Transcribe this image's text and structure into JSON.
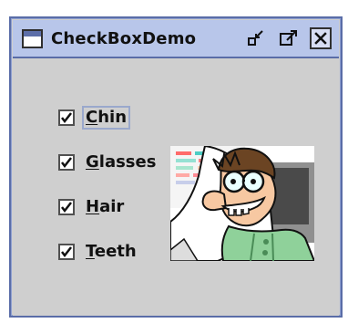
{
  "window": {
    "title": "CheckBoxDemo",
    "controls": {
      "minimize_icon": "minimize-icon",
      "maximize_icon": "maximize-icon",
      "close_icon": "close-icon"
    }
  },
  "checkboxes": [
    {
      "name": "checkbox-chin",
      "mnemonic": "C",
      "rest": "hin",
      "checked": true,
      "focused": true
    },
    {
      "name": "checkbox-glasses",
      "mnemonic": "G",
      "rest": "lasses",
      "checked": true,
      "focused": false
    },
    {
      "name": "checkbox-hair",
      "mnemonic": "H",
      "rest": "air",
      "checked": true,
      "focused": false
    },
    {
      "name": "checkbox-teeth",
      "mnemonic": "T",
      "rest": "eeth",
      "checked": true,
      "focused": false
    }
  ],
  "picture": {
    "icon": "geek-cartoon-image"
  },
  "colors": {
    "window_bg": "#cfcfcf",
    "titlebar_bg": "#b8c6ea",
    "frame": "#5a6da8"
  }
}
